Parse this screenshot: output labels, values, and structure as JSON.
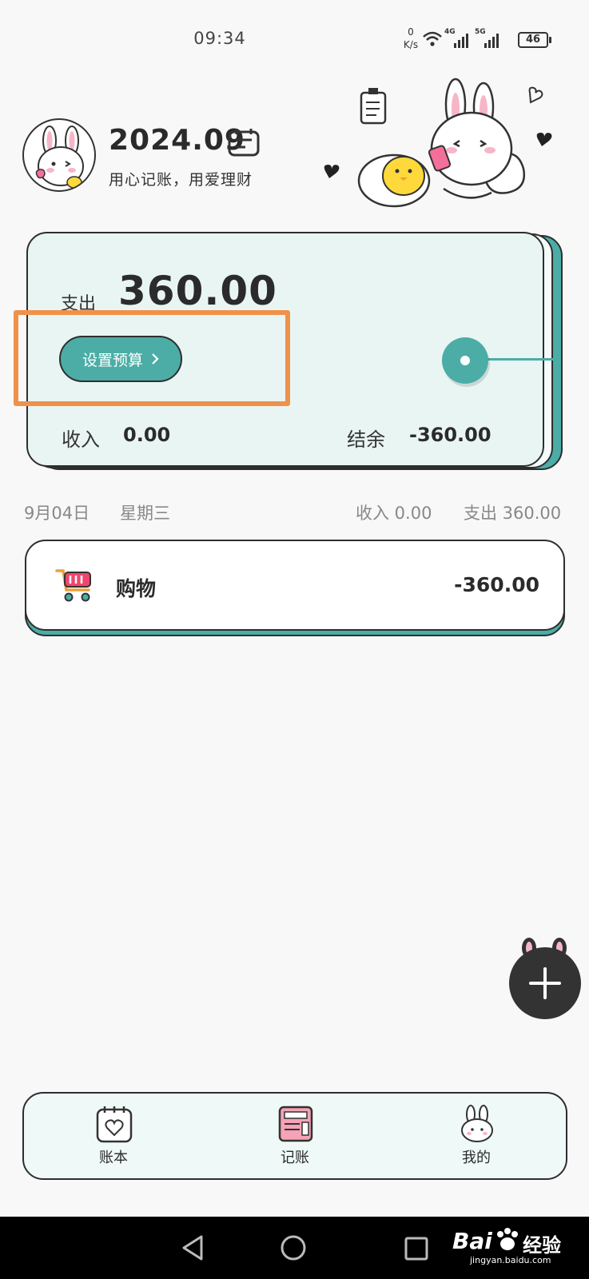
{
  "status_bar": {
    "time": "09:34",
    "net_speed_value": "0",
    "net_speed_unit": "K/s",
    "sim1": "4G",
    "sim2": "5G",
    "battery": "46"
  },
  "header": {
    "month": "2024.09",
    "slogan": "用心记账，用爱理财"
  },
  "summary": {
    "expense_label": "支出",
    "expense_value": "360.00",
    "budget_button": "设置预算",
    "income_label": "收入",
    "income_value": "0.00",
    "balance_label": "结余",
    "balance_value": "-360.00"
  },
  "day_group": {
    "date": "9月04日",
    "weekday": "星期三",
    "income": "收入 0.00",
    "expense": "支出 360.00",
    "records": [
      {
        "category": "购物",
        "amount": "-360.00",
        "icon": "shopping-cart-icon"
      }
    ]
  },
  "bottom_nav": {
    "items": [
      {
        "label": "账本",
        "icon": "calendar-heart-icon"
      },
      {
        "label": "记账",
        "icon": "notebook-icon"
      },
      {
        "label": "我的",
        "icon": "bunny-face-icon"
      }
    ]
  },
  "watermark": {
    "text_en": "Bai",
    "text_cn": "经验",
    "url": "jingyan.baidu.com"
  },
  "colors": {
    "accent": "#4bada6",
    "card_bg": "#e8f5f3",
    "highlight": "#f0914a"
  }
}
